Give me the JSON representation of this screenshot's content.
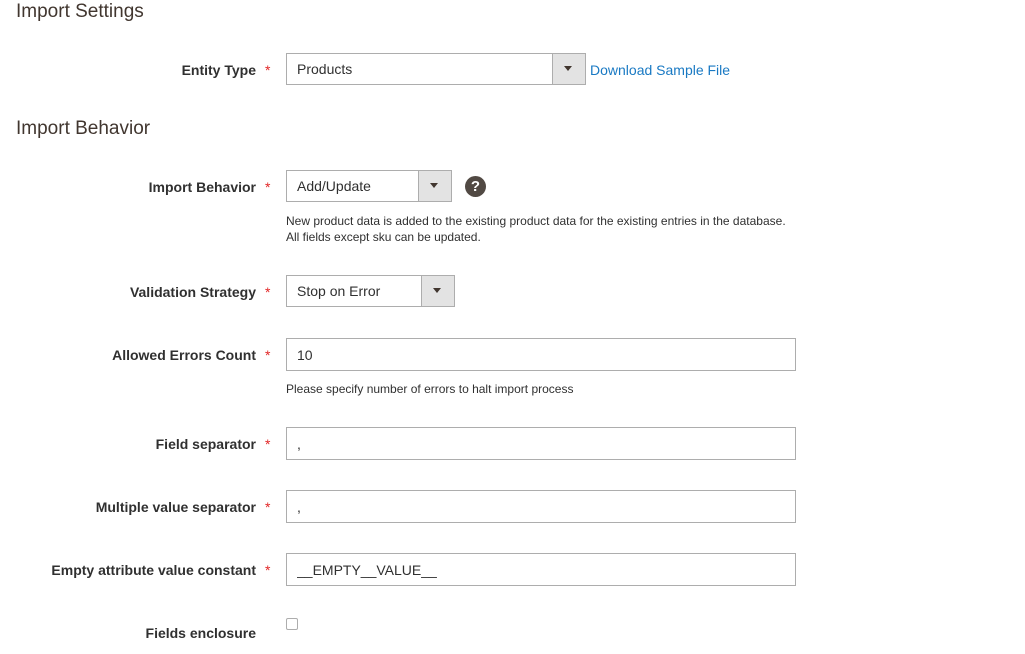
{
  "sections": {
    "import_settings": "Import Settings",
    "import_behavior": "Import Behavior"
  },
  "required_marker": "*",
  "entity_type": {
    "label": "Entity Type",
    "value": "Products",
    "sample_link": "Download Sample File"
  },
  "import_behavior": {
    "label": "Import Behavior",
    "value": "Add/Update",
    "help_icon": "question-circle-icon",
    "help_glyph": "?",
    "note": "New product data is added to the existing product data for the existing entries in the database. All fields except sku can be updated."
  },
  "validation_strategy": {
    "label": "Validation Strategy",
    "value": "Stop on Error"
  },
  "allowed_errors": {
    "label": "Allowed Errors Count",
    "value": "10",
    "note": "Please specify number of errors to halt import process"
  },
  "field_separator": {
    "label": "Field separator",
    "value": ","
  },
  "multiple_value_separator": {
    "label": "Multiple value separator",
    "value": ","
  },
  "empty_attribute": {
    "label": "Empty attribute value constant",
    "value": "__EMPTY__VALUE__"
  },
  "fields_enclosure": {
    "label": "Fields enclosure",
    "checked": false
  },
  "colors": {
    "accent_link": "#1979c3",
    "required": "#e22626",
    "text": "#303030",
    "border": "#adadad"
  }
}
